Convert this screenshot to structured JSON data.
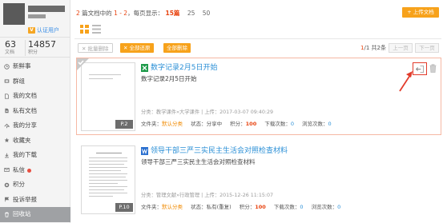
{
  "sidebar": {
    "verified_label": "认证用户",
    "stats": [
      {
        "value": "63",
        "label": "文档"
      },
      {
        "value": "14857",
        "label": "积分"
      }
    ],
    "nav": [
      {
        "label": "新鲜事",
        "icon": "news-icon"
      },
      {
        "label": "群组",
        "icon": "group-icon"
      },
      {
        "label": "我的文档",
        "icon": "document-icon"
      },
      {
        "label": "私有文档",
        "icon": "private-document-icon"
      },
      {
        "label": "我的分享",
        "icon": "share-icon"
      },
      {
        "label": "收藏夹",
        "icon": "star-icon"
      },
      {
        "label": "我的下载",
        "icon": "download-icon"
      },
      {
        "label": "私信",
        "icon": "mail-icon"
      },
      {
        "label": "积分",
        "icon": "coin-icon"
      },
      {
        "label": "投诉举报",
        "icon": "report-icon"
      },
      {
        "label": "回收站",
        "icon": "recycle-icon"
      }
    ],
    "active_item": "回收站"
  },
  "header": {
    "count_pre": "2",
    "count_text": "篇文档中的",
    "range": "1 - 2",
    "per_page_label": "，每页显示：",
    "page_sizes": [
      "15篇",
      "25",
      "50"
    ],
    "selected_page_size": "15篇",
    "upload_label": "+ 上传文档"
  },
  "toolbar": {
    "batch_delete": "批量删除",
    "restore_all": "全部还原",
    "delete_all": "全部删除",
    "page_current": "1",
    "page_total": "/1 共2条",
    "prev": "上一页",
    "next": "下一页"
  },
  "documents": [
    {
      "title": "数字记录2月5日开始",
      "description": "数字记录2月5日开始",
      "meta": "分类：教学课件»大学课件 | 上传：2017-03-07 09:40:29",
      "page_badge": "P.2",
      "folder_label": "文件夹：",
      "folder_value": "默认分类",
      "status_label": "状态：",
      "status_value": "分享中",
      "points_label": "积分：",
      "points_value": "100",
      "downloads_label": "下载次数：",
      "downloads_value": "0",
      "views_label": "浏览次数：",
      "views_value": "0"
    },
    {
      "title": "领导干部三严三实民主生活会对照检查材料",
      "description": "领导干部三严三实民主生活会对照检查材料",
      "meta": "分类：管理文献»行政管理 | 上传：2015-12-26 11:15:07",
      "page_badge": "P.10",
      "folder_label": "文件夹：",
      "folder_value": "默认分类",
      "status_label": "状态：",
      "status_value": "私有(重复)",
      "points_label": "积分：",
      "points_value": "100",
      "downloads_label": "下载次数：",
      "downloads_value": "0",
      "views_label": "浏览次数：",
      "views_value": "0"
    }
  ],
  "colors": {
    "accent_orange": "#f7a21b",
    "link_blue": "#2a8fd6",
    "highlight_red": "#e8430f",
    "annotation_red": "#e23b2b"
  }
}
